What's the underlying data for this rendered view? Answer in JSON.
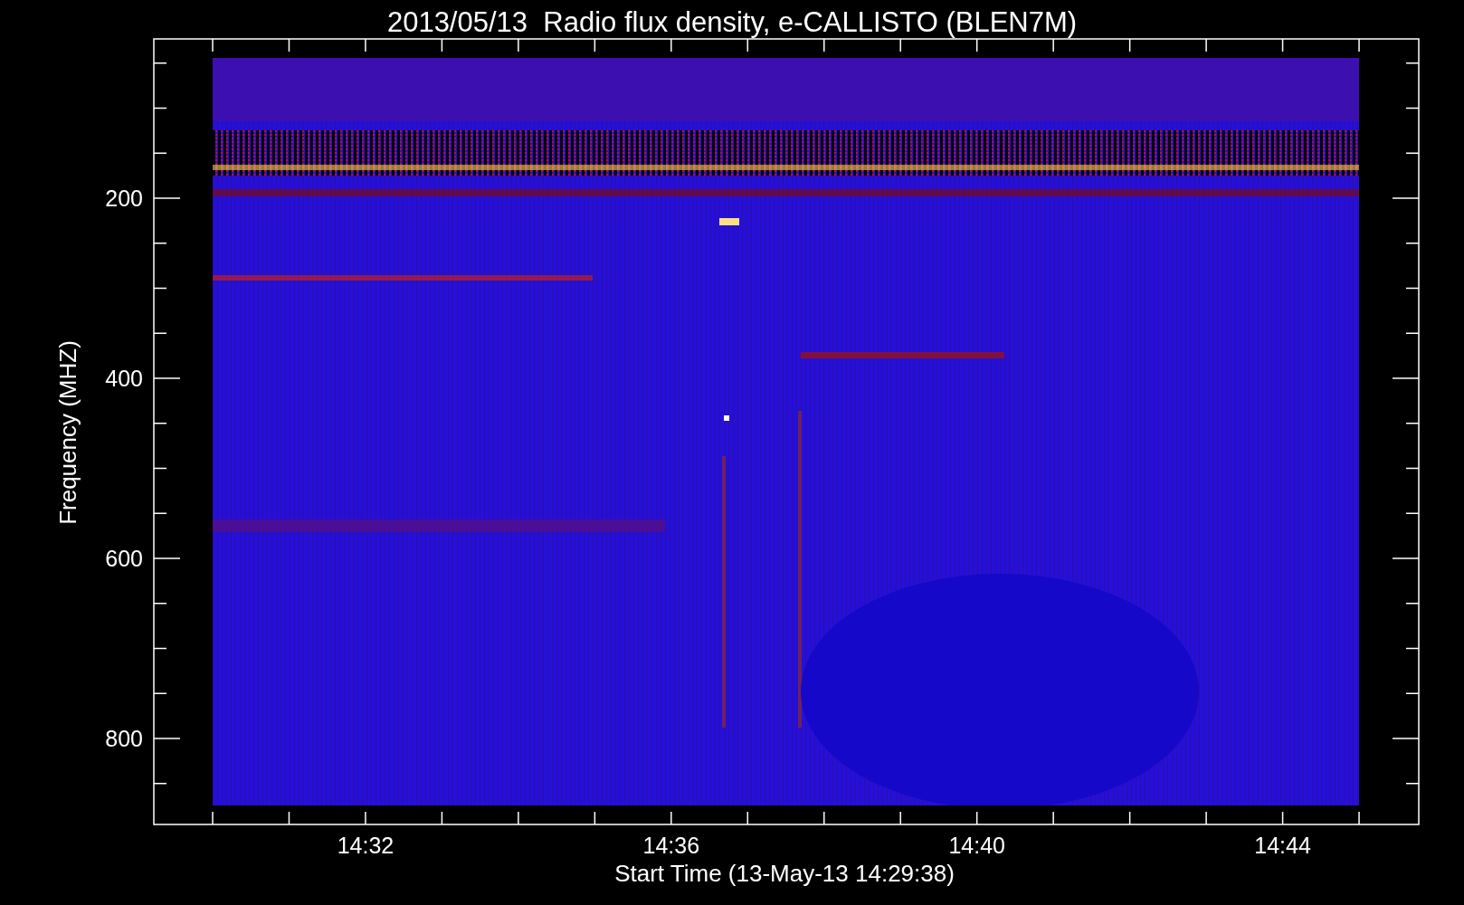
{
  "title": "2013/05/13  Radio flux density, e-CALLISTO (BLEN7M)",
  "plot": {
    "ylabel": "Frequency (MHZ)",
    "xlabel": "Start Time (13-May-13 14:29:38)",
    "yticks": [
      "200",
      "400",
      "600",
      "800"
    ],
    "xticks": [
      "14:32",
      "14:36",
      "14:40",
      "14:44"
    ]
  }
}
